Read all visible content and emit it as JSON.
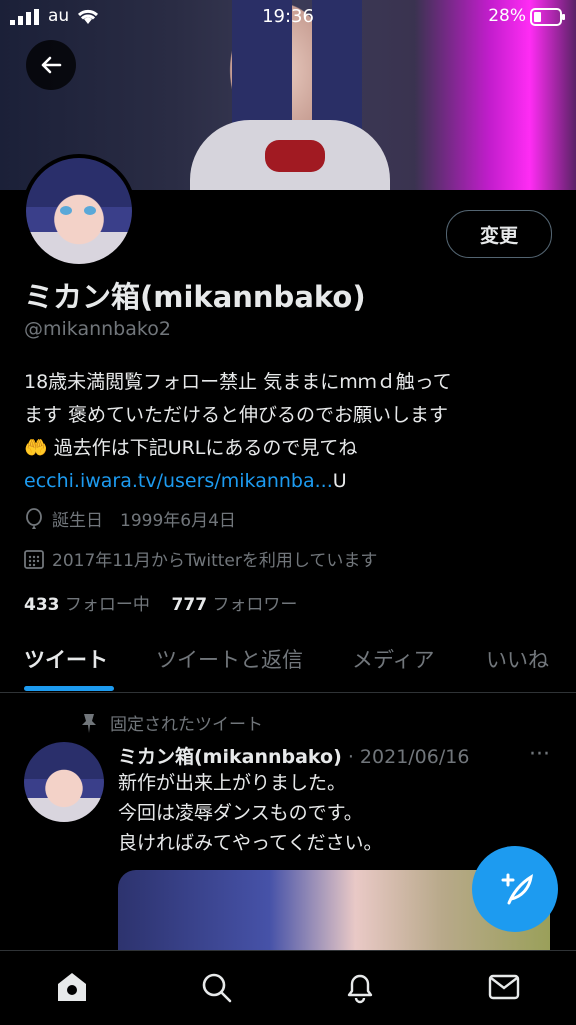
{
  "status_bar": {
    "carrier": "au",
    "time": "19:36",
    "battery": "28%"
  },
  "profile": {
    "edit_label": "変更",
    "display_name": "ミカン箱(mikannbako)",
    "handle": "@mikannbako2",
    "bio_line1": "18歳未満閲覧フォロー禁止 気ままにmｍｄ触って",
    "bio_line2": "ます 褒めていただけると伸びるのでお願いします",
    "bio_line3": "🤲 過去作は下記URLにあるので見てね",
    "bio_link": "ecchi.iwara.tv/users/mikannba...",
    "bio_link_suffix": "U",
    "birthday": "誕生日　1999年6月4日",
    "joined": "2017年11月からTwitterを利用しています",
    "following_count": "433",
    "following_label": "フォロー中",
    "followers_count": "777",
    "followers_label": "フォロワー"
  },
  "tabs": [
    {
      "label": "ツイート",
      "active": true
    },
    {
      "label": "ツイートと返信",
      "active": false
    },
    {
      "label": "メディア",
      "active": false
    },
    {
      "label": "いいね",
      "active": false
    }
  ],
  "tweet": {
    "pinned_label": "固定されたツイート",
    "author": "ミカン箱(mikannbako)",
    "date": "· 2021/06/16",
    "more": "···",
    "text": "新作が出来上がりました。\n今回は凌辱ダンスものです。\n良ければみてやってください。"
  },
  "colors": {
    "accent": "#1d9bf0",
    "background": "#000000",
    "secondary_text": "#71767b"
  },
  "icons": {
    "back": "arrow-left-icon",
    "compose": "feather-plus-icon",
    "home": "home-icon",
    "search": "search-icon",
    "notifications": "bell-icon",
    "messages": "mail-icon"
  }
}
